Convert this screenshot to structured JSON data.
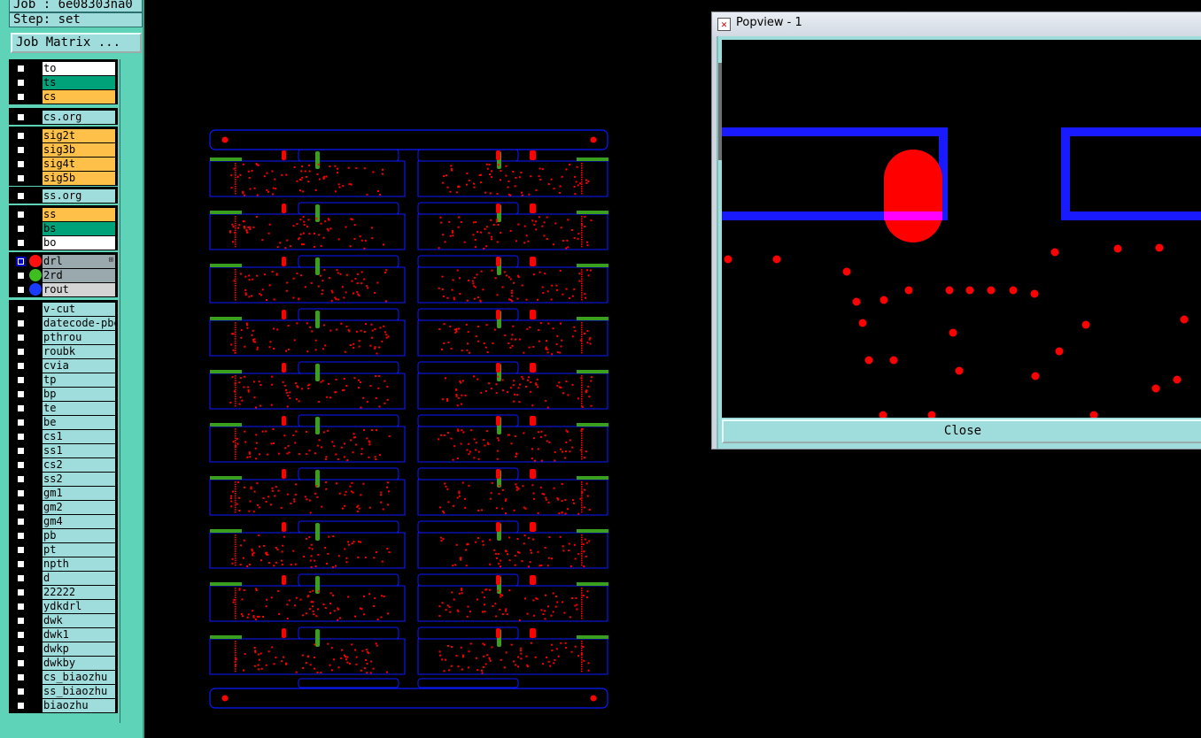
{
  "header": {
    "job_line": "Job : 6e08303na0",
    "step_line": "Step: set",
    "job_matrix_label": "Job Matrix ..."
  },
  "layers": [
    {
      "name": "to",
      "color": "white"
    },
    {
      "name": "ts",
      "color": "green"
    },
    {
      "name": "cs",
      "color": "orange"
    },
    {
      "name": "cs.org",
      "color": "cyan"
    },
    {
      "name": "sig2t",
      "color": "orange"
    },
    {
      "name": "sig3b",
      "color": "orange"
    },
    {
      "name": "sig4t",
      "color": "orange"
    },
    {
      "name": "sig5b",
      "color": "orange"
    },
    {
      "name": "ss.org",
      "color": "cyan"
    },
    {
      "name": "ss",
      "color": "orange"
    },
    {
      "name": "bs",
      "color": "green"
    },
    {
      "name": "bo",
      "color": "white"
    },
    {
      "name": "drl",
      "color": "gray",
      "dot": "#ff1010",
      "checked": true
    },
    {
      "name": "2rd",
      "color": "gray",
      "dot": "#3fbf1f"
    },
    {
      "name": "rout",
      "color": "lightgray",
      "dot": "#1a3cff"
    },
    {
      "name": "v-cut",
      "color": "cyan"
    },
    {
      "name": "datecode-pbe",
      "color": "cyan"
    },
    {
      "name": "pthrou",
      "color": "cyan"
    },
    {
      "name": "roubk",
      "color": "cyan"
    },
    {
      "name": "cvia",
      "color": "cyan"
    },
    {
      "name": "tp",
      "color": "cyan"
    },
    {
      "name": "bp",
      "color": "cyan"
    },
    {
      "name": "te",
      "color": "cyan"
    },
    {
      "name": "be",
      "color": "cyan"
    },
    {
      "name": "cs1",
      "color": "cyan"
    },
    {
      "name": "ss1",
      "color": "cyan"
    },
    {
      "name": "cs2",
      "color": "cyan"
    },
    {
      "name": "ss2",
      "color": "cyan"
    },
    {
      "name": "gm1",
      "color": "cyan"
    },
    {
      "name": "gm2",
      "color": "cyan"
    },
    {
      "name": "gm4",
      "color": "cyan"
    },
    {
      "name": "pb",
      "color": "cyan"
    },
    {
      "name": "pt",
      "color": "cyan"
    },
    {
      "name": "npth",
      "color": "cyan"
    },
    {
      "name": "d",
      "color": "cyan"
    },
    {
      "name": "22222",
      "color": "cyan"
    },
    {
      "name": "ydkdrl",
      "color": "cyan"
    },
    {
      "name": "dwk",
      "color": "cyan"
    },
    {
      "name": "dwk1",
      "color": "cyan"
    },
    {
      "name": "dwkp",
      "color": "cyan"
    },
    {
      "name": "dwkby",
      "color": "cyan"
    },
    {
      "name": "cs_biaozhu",
      "color": "cyan"
    },
    {
      "name": "ss_biaozhu",
      "color": "cyan"
    },
    {
      "name": "biaozhu",
      "color": "cyan"
    }
  ],
  "popview": {
    "title": "Popview - 1",
    "close_label": "Close"
  },
  "colors": {
    "panel_bg": "#5fd3b8",
    "outline_blue": "#0a1aff",
    "drill_red": "#ff0000",
    "vcut_green": "#3a9f1c"
  }
}
